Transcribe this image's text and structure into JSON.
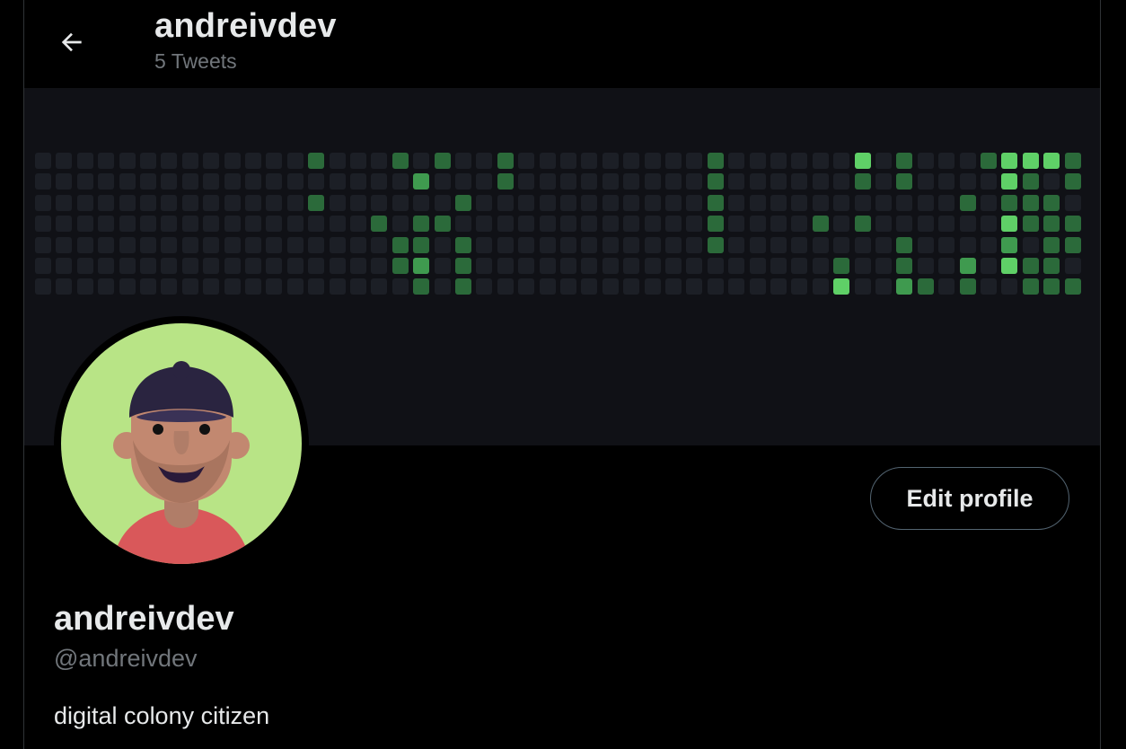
{
  "header": {
    "title": "andreivdev",
    "tweet_count": "5 Tweets",
    "back_icon": "arrow-left-icon"
  },
  "banner": {
    "description_icon": "contribution-graph",
    "colors": {
      "empty": "#1c1f26",
      "level1": "#1f4a2b",
      "level2": "#2b6a3a",
      "level3": "#3f9a4f",
      "level4": "#5fd067"
    }
  },
  "profile": {
    "display_name": "andreivdev",
    "handle": "@andreivdev",
    "bio": "digital colony citizen",
    "edit_button_label": "Edit profile",
    "avatar_icon": "avatar-illustration"
  },
  "colors": {
    "background": "#000000",
    "text_primary": "#e7e9ea",
    "text_secondary": "#71767b",
    "border": "#2f3336",
    "avatar_bg": "#b8e486"
  }
}
